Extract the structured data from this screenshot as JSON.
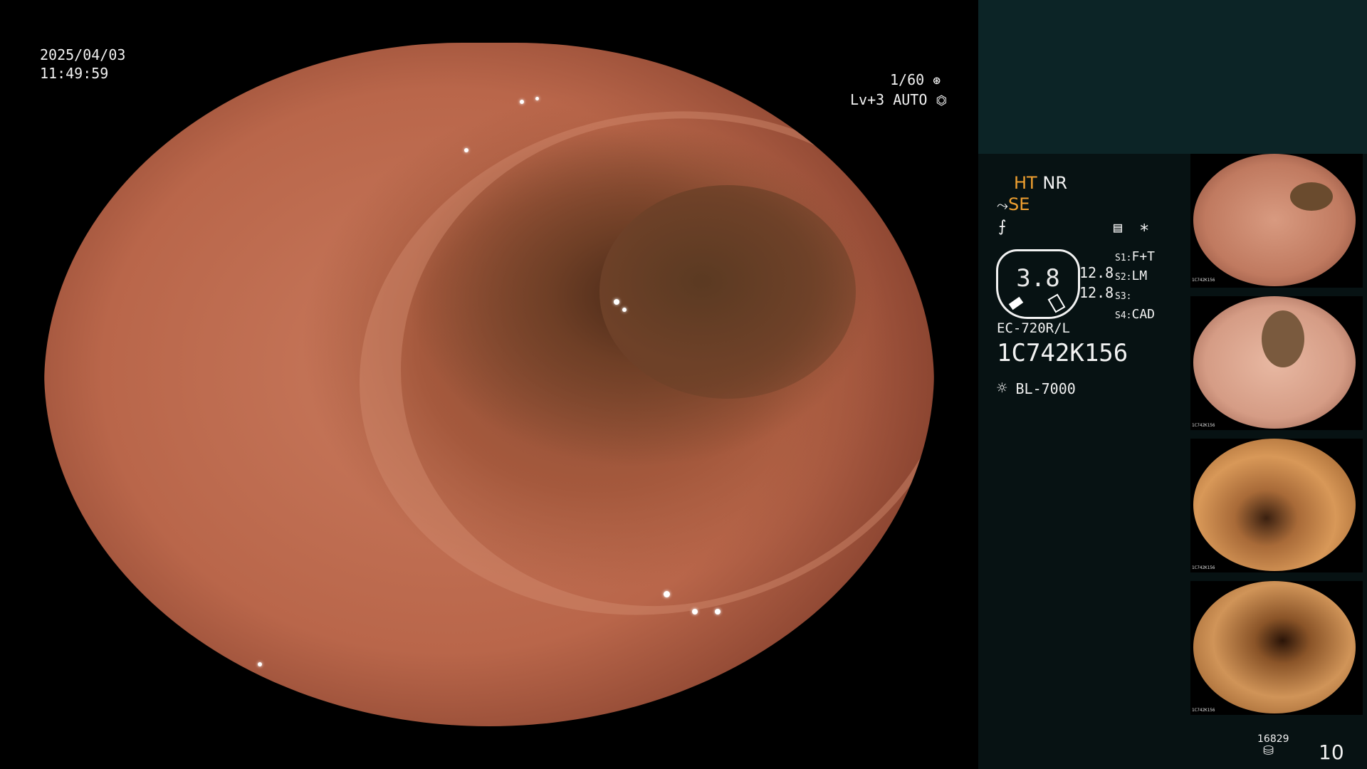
{
  "overlay": {
    "date": "2025/04/03",
    "time": "11:49:59",
    "shutter": "1/60",
    "level": "Lv+3",
    "iris_mode": "AUTO"
  },
  "panel": {
    "ht": "HT",
    "nr": "NR",
    "se": "SE",
    "gauge_value": "3.8",
    "val_top": "12.8",
    "val_bottom": "12.8",
    "s_labels": [
      "S1:",
      "S2:",
      "S3:",
      "S4:"
    ],
    "s_values": [
      "F+T",
      "LM",
      "",
      "CAD"
    ],
    "scope_model": "EC-720R/L",
    "scope_serial": "1C742K156",
    "light_source": "BL-7000",
    "counter_small": "16829",
    "counter_big": "10",
    "thumb_labels": [
      "1C742K156",
      "1C742K156",
      "1C742K156",
      "1C742K156"
    ]
  },
  "colors": {
    "accent_orange": "#f0a030",
    "panel_bg": "#071213",
    "panel_top_bg": "#0c2426"
  },
  "icons": {
    "shutter": "aperture-icon",
    "iris": "iris-icon",
    "structure": "structure-enhance-icon",
    "color": "color-mode-icon",
    "menu": "menu-list-icon",
    "asterisk": "asterisk-icon",
    "light": "sun-icon",
    "disk": "disk-icon"
  }
}
